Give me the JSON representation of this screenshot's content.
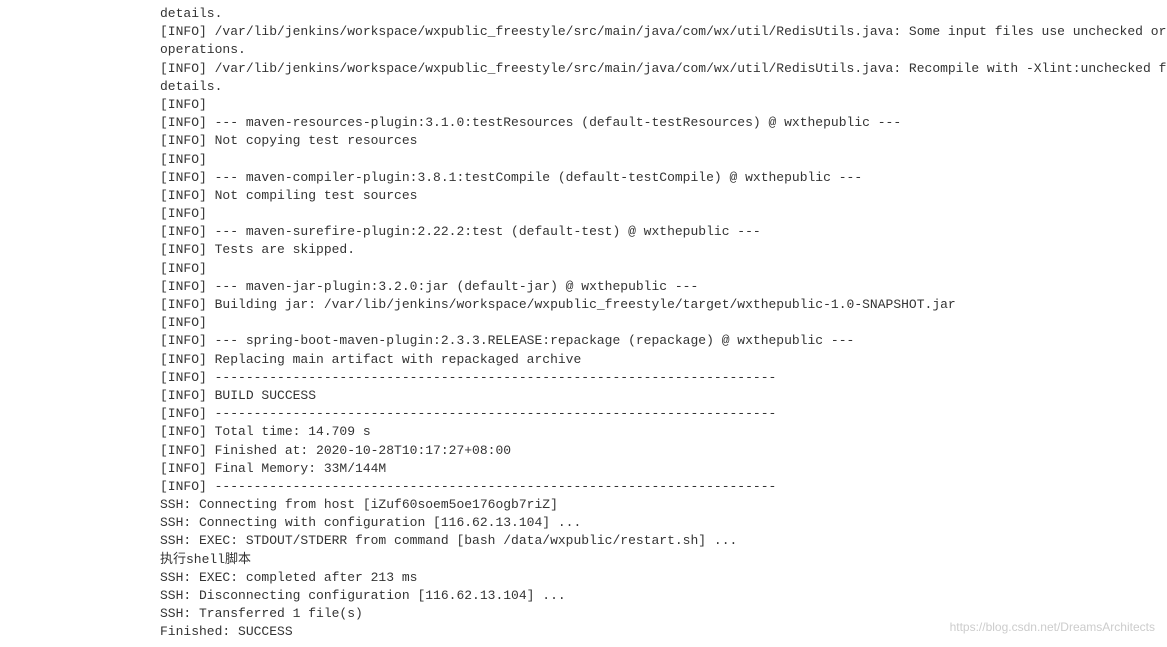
{
  "console": {
    "lines": [
      "details.",
      "[INFO] /var/lib/jenkins/workspace/wxpublic_freestyle/src/main/java/com/wx/util/RedisUtils.java: Some input files use unchecked or uns",
      "operations.",
      "[INFO] /var/lib/jenkins/workspace/wxpublic_freestyle/src/main/java/com/wx/util/RedisUtils.java: Recompile with -Xlint:unchecked for",
      "details.",
      "[INFO]",
      "[INFO] --- maven-resources-plugin:3.1.0:testResources (default-testResources) @ wxthepublic ---",
      "[INFO] Not copying test resources",
      "[INFO]",
      "[INFO] --- maven-compiler-plugin:3.8.1:testCompile (default-testCompile) @ wxthepublic ---",
      "[INFO] Not compiling test sources",
      "[INFO]",
      "[INFO] --- maven-surefire-plugin:2.22.2:test (default-test) @ wxthepublic ---",
      "[INFO] Tests are skipped.",
      "[INFO]",
      "[INFO] --- maven-jar-plugin:3.2.0:jar (default-jar) @ wxthepublic ---",
      "[INFO] Building jar: /var/lib/jenkins/workspace/wxpublic_freestyle/target/wxthepublic-1.0-SNAPSHOT.jar",
      "[INFO]",
      "[INFO] --- spring-boot-maven-plugin:2.3.3.RELEASE:repackage (repackage) @ wxthepublic ---",
      "[INFO] Replacing main artifact with repackaged archive",
      "[INFO] ------------------------------------------------------------------------",
      "[INFO] BUILD SUCCESS",
      "[INFO] ------------------------------------------------------------------------",
      "[INFO] Total time: 14.709 s",
      "[INFO] Finished at: 2020-10-28T10:17:27+08:00",
      "[INFO] Final Memory: 33M/144M",
      "[INFO] ------------------------------------------------------------------------",
      "SSH: Connecting from host [iZuf60soem5oe176ogb7riZ]",
      "SSH: Connecting with configuration [116.62.13.104] ...",
      "SSH: EXEC: STDOUT/STDERR from command [bash /data/wxpublic/restart.sh] ...",
      "执行shell脚本",
      "SSH: EXEC: completed after 213 ms",
      "SSH: Disconnecting configuration [116.62.13.104] ...",
      "SSH: Transferred 1 file(s)",
      "Finished: SUCCESS"
    ]
  },
  "watermark": "https://blog.csdn.net/DreamsArchitects"
}
